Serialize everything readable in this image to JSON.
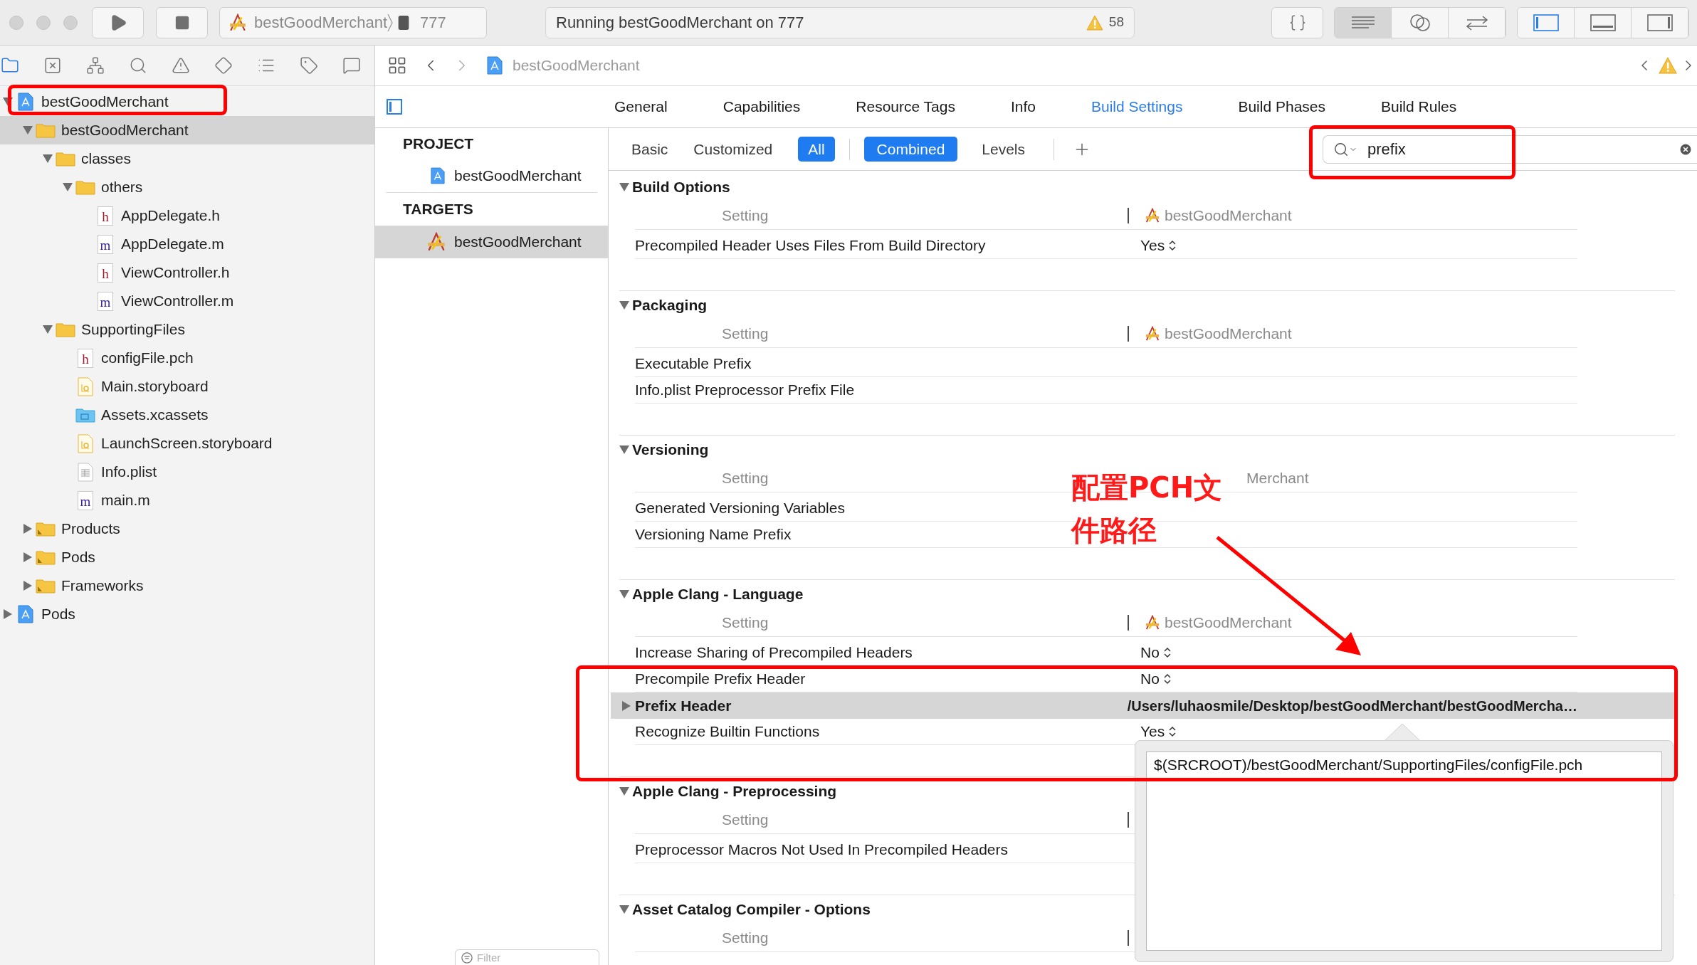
{
  "toolbar": {
    "scheme": "bestGoodMerchant",
    "device": "777",
    "activity": "Running bestGoodMerchant on 777",
    "warning_count": "58",
    "editor_modes": [
      {
        "kind": "standard",
        "selected": true
      },
      {
        "kind": "assistant",
        "selected": false
      },
      {
        "kind": "version",
        "selected": false
      }
    ],
    "panels": [
      {
        "kind": "navigator",
        "on": true
      },
      {
        "kind": "debug",
        "on": false
      },
      {
        "kind": "utilities",
        "on": false
      }
    ]
  },
  "navigator": {
    "tabs": [
      {
        "kind": "project",
        "selected": true
      },
      {
        "kind": "source-control",
        "selected": false
      },
      {
        "kind": "symbol",
        "selected": false
      },
      {
        "kind": "find",
        "selected": false
      },
      {
        "kind": "issue",
        "selected": false
      },
      {
        "kind": "test",
        "selected": false
      },
      {
        "kind": "debug",
        "selected": false
      },
      {
        "kind": "breakpoint",
        "selected": false
      },
      {
        "kind": "report",
        "selected": false
      }
    ],
    "tree": [
      {
        "label": "bestGoodMerchant",
        "kind": "project",
        "expanded": true,
        "selected": false,
        "children": [
          {
            "label": "bestGoodMerchant",
            "kind": "folder",
            "expanded": true,
            "selected": true,
            "children": [
              {
                "label": "classes",
                "kind": "folder",
                "expanded": true,
                "selected": false,
                "children": [
                  {
                    "label": "others",
                    "kind": "folder",
                    "expanded": true,
                    "selected": false,
                    "children": [
                      {
                        "label": "AppDelegate.h",
                        "kind": "file",
                        "glyph": "h",
                        "selected": false
                      },
                      {
                        "label": "AppDelegate.m",
                        "kind": "file",
                        "glyph": "m",
                        "selected": false
                      },
                      {
                        "label": "ViewController.h",
                        "kind": "file",
                        "glyph": "h",
                        "selected": false
                      },
                      {
                        "label": "ViewController.m",
                        "kind": "file",
                        "glyph": "m",
                        "selected": false
                      }
                    ]
                  }
                ]
              },
              {
                "label": "SupportingFiles",
                "kind": "folder",
                "expanded": true,
                "selected": false,
                "children": [
                  {
                    "label": "configFile.pch",
                    "kind": "file",
                    "glyph": "h",
                    "selected": false
                  },
                  {
                    "label": "Main.storyboard",
                    "kind": "storyboard",
                    "selected": false
                  },
                  {
                    "label": "Assets.xcassets",
                    "kind": "assets",
                    "selected": false
                  },
                  {
                    "label": "LaunchScreen.storyboard",
                    "kind": "storyboard",
                    "selected": false
                  },
                  {
                    "label": "Info.plist",
                    "kind": "plist",
                    "selected": false
                  },
                  {
                    "label": "main.m",
                    "kind": "file",
                    "glyph": "m",
                    "selected": false
                  }
                ]
              }
            ]
          },
          {
            "label": "Products",
            "kind": "group",
            "expanded": false,
            "selected": false
          },
          {
            "label": "Pods",
            "kind": "group",
            "expanded": false,
            "selected": false
          },
          {
            "label": "Frameworks",
            "kind": "group",
            "expanded": false,
            "selected": false
          }
        ]
      },
      {
        "label": "Pods",
        "kind": "project",
        "expanded": false,
        "selected": false
      }
    ]
  },
  "jump_bar": {
    "file": "bestGoodMerchant"
  },
  "editor_tabs": [
    {
      "label": "General",
      "selected": false
    },
    {
      "label": "Capabilities",
      "selected": false
    },
    {
      "label": "Resource Tags",
      "selected": false
    },
    {
      "label": "Info",
      "selected": false
    },
    {
      "label": "Build Settings",
      "selected": true
    },
    {
      "label": "Build Phases",
      "selected": false
    },
    {
      "label": "Build Rules",
      "selected": false
    }
  ],
  "project_list": {
    "project_header": "PROJECT",
    "projects": [
      {
        "label": "bestGoodMerchant",
        "selected": false
      }
    ],
    "targets_header": "TARGETS",
    "targets": [
      {
        "label": "bestGoodMerchant",
        "selected": true
      }
    ],
    "filter": {
      "placeholder": "Filter"
    }
  },
  "build_settings": {
    "scopes": [
      {
        "label": "Basic",
        "selected": false
      },
      {
        "label": "Customized",
        "selected": false
      },
      {
        "label": "All",
        "selected": true
      }
    ],
    "views": [
      {
        "label": "Combined",
        "selected": true
      },
      {
        "label": "Levels",
        "selected": false
      }
    ],
    "search": {
      "value": "prefix"
    },
    "sections": [
      {
        "title": "Build Options",
        "expanded": true,
        "setting_label": "Setting",
        "target": "bestGoodMerchant",
        "target_icon": true,
        "divider": true,
        "rows": [
          {
            "name": "Precompiled Header Uses Files From Build Directory",
            "kind": "plain",
            "value": "Yes",
            "selected": false
          }
        ]
      },
      {
        "title": "Packaging",
        "expanded": true,
        "setting_label": "Setting",
        "target": "bestGoodMerchant",
        "target_icon": true,
        "divider": true,
        "rows": [
          {
            "name": "Executable Prefix",
            "kind": "plain",
            "selected": false
          },
          {
            "name": "Info.plist Preprocessor Prefix File",
            "kind": "plain",
            "selected": false
          }
        ]
      },
      {
        "title": "Versioning",
        "expanded": true,
        "setting_label": "Setting",
        "target": "Merchant",
        "target_icon": false,
        "divider": false,
        "rows": [
          {
            "name": "Generated Versioning Variables",
            "kind": "plain",
            "selected": false
          },
          {
            "name": "Versioning Name Prefix",
            "kind": "plain",
            "selected": false
          }
        ]
      },
      {
        "title": "Apple Clang - Language",
        "expanded": true,
        "setting_label": "Setting",
        "target": "bestGoodMerchant",
        "target_icon": true,
        "divider": true,
        "rows": [
          {
            "name": "Increase Sharing of Precompiled Headers",
            "kind": "plain",
            "value": "No",
            "selected": false
          },
          {
            "name": "Precompile Prefix Header",
            "kind": "plain",
            "value": "No",
            "selected": false
          },
          {
            "name": "Prefix Header",
            "kind": "group",
            "expanded": false,
            "value": "/Users/luhaosmile/Desktop/bestGoodMerchant/bestGoodMercha…",
            "selected": true
          },
          {
            "name": "Recognize Builtin Functions",
            "kind": "plain",
            "value": "Yes",
            "selected": false
          }
        ]
      },
      {
        "title": "Apple Clang - Preprocessing",
        "expanded": true,
        "setting_label": "Setting",
        "divider": true,
        "rows": [
          {
            "name": "Preprocessor Macros Not Used In Precompiled Headers",
            "kind": "plain",
            "selected": false
          }
        ]
      },
      {
        "title": "Asset Catalog Compiler - Options",
        "expanded": true,
        "setting_label": "Setting",
        "divider": true
      }
    ],
    "popup": {
      "value": "$(SRCROOT)/bestGoodMerchant/SupportingFiles/configFile.pch"
    }
  },
  "annotation": {
    "callout": "配置PCH文件路径"
  }
}
